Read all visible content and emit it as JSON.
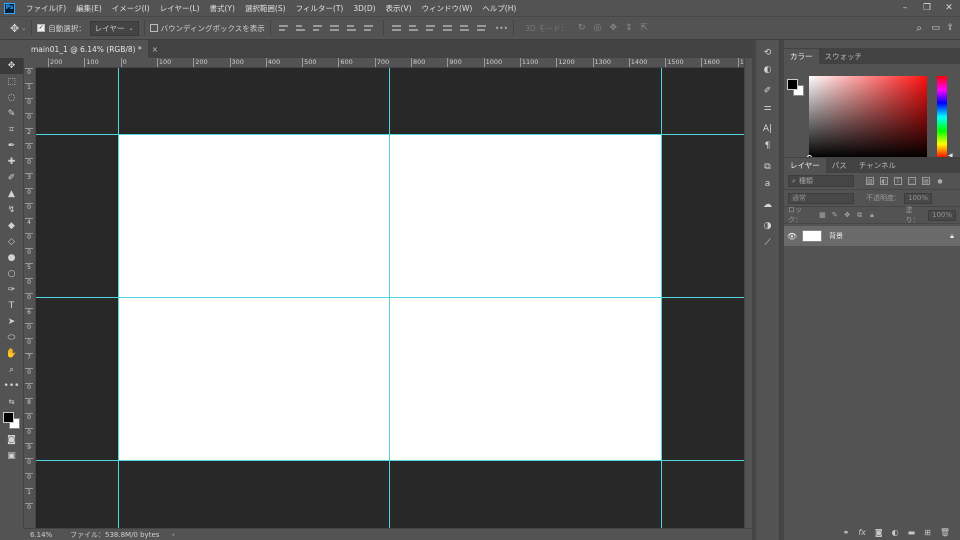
{
  "app": {
    "logo": "Ps"
  },
  "menu": [
    "ファイル(F)",
    "編集(E)",
    "イメージ(I)",
    "レイヤー(L)",
    "書式(Y)",
    "選択範囲(S)",
    "フィルター(T)",
    "3D(D)",
    "表示(V)",
    "ウィンドウ(W)",
    "ヘルプ(H)"
  ],
  "window_controls": {
    "minimize": "–",
    "restore": "❐",
    "close": "✕"
  },
  "options_bar": {
    "tool_icon": "move-tool-icon",
    "auto_select_label": "自動選択：",
    "auto_select_checked": true,
    "auto_select_target": "レイヤー",
    "bounding_box_label": "バウンディングボックスを表示",
    "mode_3d_label": "3D モード："
  },
  "document": {
    "tab_title": "main01_1 @ 6.14% (RGB/8) *",
    "close_glyph": "×"
  },
  "ruler_h": [
    "200",
    "100",
    "0",
    "100",
    "200",
    "300",
    "400",
    "500",
    "600",
    "700",
    "800",
    "900",
    "1000",
    "1100",
    "1200",
    "1300",
    "1400",
    "1500",
    "1600",
    "1700"
  ],
  "ruler_v": [
    "0",
    "1",
    "0",
    "0",
    "2",
    "0",
    "0",
    "3",
    "0",
    "0",
    "4",
    "0",
    "0",
    "5",
    "0",
    "0",
    "6",
    "0",
    "0",
    "7",
    "0",
    "0",
    "8",
    "0",
    "0",
    "9",
    "0",
    "0",
    "1",
    "0"
  ],
  "status": {
    "zoom": "6.14%",
    "file_info": "ファイル：538.8M/0 bytes",
    "arrow": "›"
  },
  "color_panel": {
    "tabs": [
      "カラー",
      "スウォッチ"
    ],
    "active_tab": "カラー",
    "foreground": "#000000",
    "background": "#ffffff",
    "field_hue": "#ff1010"
  },
  "layers_panel": {
    "tabs": [
      "レイヤー",
      "パス",
      "チャンネル"
    ],
    "active_tab": "レイヤー",
    "filter_placeholder": "種類",
    "blend_mode": "通常",
    "opacity_label": "不透明度：",
    "opacity_value": "100%",
    "lock_label": "ロック：",
    "fill_label": "塗り：",
    "fill_value": "100%",
    "layers": [
      {
        "name": "背景",
        "visible": true,
        "locked": true
      }
    ]
  }
}
